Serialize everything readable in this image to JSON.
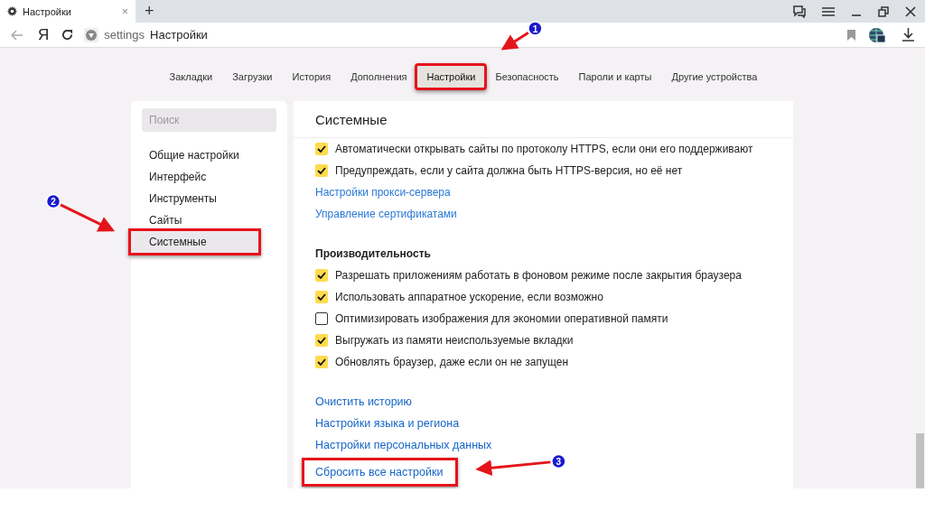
{
  "browser": {
    "tab": {
      "title": "Настройки",
      "close": "×"
    },
    "new_tab": "+",
    "yandex": "Я",
    "address": {
      "host": "settings",
      "title": "Настройки"
    }
  },
  "nav": [
    {
      "label": "Закладки",
      "selected": false,
      "highlighted": false
    },
    {
      "label": "Загрузки",
      "selected": false,
      "highlighted": false
    },
    {
      "label": "История",
      "selected": false,
      "highlighted": false
    },
    {
      "label": "Дополнения",
      "selected": false,
      "highlighted": false
    },
    {
      "label": "Настройки",
      "selected": true,
      "highlighted": true
    },
    {
      "label": "Безопасность",
      "selected": false,
      "highlighted": false
    },
    {
      "label": "Пароли и карты",
      "selected": false,
      "highlighted": false
    },
    {
      "label": "Другие устройства",
      "selected": false,
      "highlighted": false
    }
  ],
  "sidebar": {
    "search": {
      "placeholder": "Поиск"
    },
    "items": [
      {
        "label": "Общие настройки",
        "selected": false,
        "highlighted": false
      },
      {
        "label": "Интерфейс",
        "selected": false,
        "highlighted": false
      },
      {
        "label": "Инструменты",
        "selected": false,
        "highlighted": false
      },
      {
        "label": "Сайты",
        "selected": false,
        "highlighted": false
      },
      {
        "label": "Системные",
        "selected": true,
        "highlighted": true
      }
    ]
  },
  "main": {
    "title": "Системные",
    "sections": [
      {
        "items": [
          {
            "kind": "checkbox",
            "label": "Автоматически открывать сайты по протоколу HTTPS, если они его поддерживают",
            "checked": true
          },
          {
            "kind": "checkbox",
            "label": "Предупреждать, если у сайта должна быть HTTPS-версия, но её нет",
            "checked": true
          },
          {
            "kind": "link",
            "label": "Настройки прокси-сервера",
            "highlighted": false
          },
          {
            "kind": "link",
            "label": "Управление сертификатами",
            "highlighted": false
          }
        ]
      },
      {
        "title": "Производительность",
        "items": [
          {
            "kind": "checkbox",
            "label": "Разрешать приложениям работать в фоновом режиме после закрытия браузера",
            "checked": true
          },
          {
            "kind": "checkbox",
            "label": "Использовать аппаратное ускорение, если возможно",
            "checked": true
          },
          {
            "kind": "checkbox",
            "label": "Оптимизировать изображения для экономии оперативной памяти",
            "checked": false
          },
          {
            "kind": "checkbox",
            "label": "Выгружать из памяти неиспользуемые вкладки",
            "checked": true
          },
          {
            "kind": "checkbox",
            "label": "Обновлять браузер, даже если он не запущен",
            "checked": true
          }
        ]
      },
      {
        "items": [
          {
            "kind": "link",
            "label": "Очистить историю",
            "highlighted": false
          },
          {
            "kind": "link",
            "label": "Настройки языка и региона",
            "highlighted": false
          },
          {
            "kind": "link",
            "label": "Настройки персональных данных",
            "highlighted": false
          },
          {
            "kind": "link",
            "label": "Сбросить все настройки",
            "highlighted": true
          }
        ]
      }
    ]
  },
  "annotations": [
    {
      "number": "1"
    },
    {
      "number": "2"
    },
    {
      "number": "3"
    }
  ]
}
